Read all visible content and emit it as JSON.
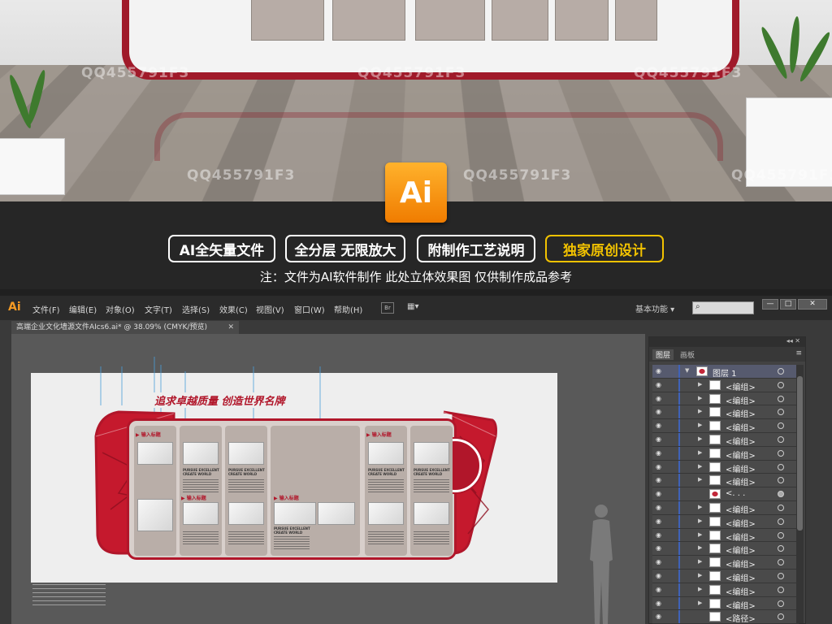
{
  "watermark_text": "QQ455791F3",
  "badge_ai": "Ai",
  "features": [
    "AI全矢量文件",
    "全分层 无限放大",
    "附制作工艺说明",
    "独家原创设计"
  ],
  "note": "注：文件为AI软件制作 此处立体效果图 仅供制作成品参考",
  "app": {
    "icon": "Ai",
    "menus": [
      "文件(F)",
      "编辑(E)",
      "对象(O)",
      "文字(T)",
      "选择(S)",
      "效果(C)",
      "视图(V)",
      "窗口(W)",
      "帮助(H)"
    ],
    "bridge_label": "Br",
    "workspace": "基本功能",
    "window_buttons": [
      "—",
      "□",
      "✕"
    ],
    "document_tab": "高端企业文化墙源文件AIcs6.ai* @ 38.09% (CMYK/预览)",
    "document_close": "✕"
  },
  "artboard": {
    "title": "追求卓越质量 创造世界名牌",
    "section_heading": "输入标题",
    "card_text": "PURSUE EXCELLENT CREATE WORLD"
  },
  "layers_panel": {
    "tabs": [
      "图层",
      "画板"
    ],
    "controls": "◂◂ ✕",
    "menu": "≡",
    "rows": [
      {
        "name": "图层 1",
        "level": 0,
        "arrow": "▼",
        "thumb": "red-small",
        "top": true
      },
      {
        "name": "<编组>",
        "level": 1,
        "arrow": "▶",
        "thumb": "plain"
      },
      {
        "name": "<编组>",
        "level": 1,
        "arrow": "▶",
        "thumb": "plain"
      },
      {
        "name": "<编组>",
        "level": 1,
        "arrow": "▶",
        "thumb": "plain"
      },
      {
        "name": "<编组>",
        "level": 1,
        "arrow": "▶",
        "thumb": "plain"
      },
      {
        "name": "<编组>",
        "level": 1,
        "arrow": "▶",
        "thumb": "plain"
      },
      {
        "name": "<编组>",
        "level": 1,
        "arrow": "▶",
        "thumb": "plain"
      },
      {
        "name": "<编组>",
        "level": 1,
        "arrow": "▶",
        "thumb": "plain"
      },
      {
        "name": "<编组>",
        "level": 1,
        "arrow": "▶",
        "thumb": "plain"
      },
      {
        "name": "<. . .",
        "level": 1,
        "arrow": "",
        "thumb": "red",
        "filled": true
      },
      {
        "name": "<编组>",
        "level": 1,
        "arrow": "▶",
        "thumb": "plain"
      },
      {
        "name": "<编组>",
        "level": 1,
        "arrow": "▶",
        "thumb": "plain"
      },
      {
        "name": "<编组>",
        "level": 1,
        "arrow": "▶",
        "thumb": "plain"
      },
      {
        "name": "<编组>",
        "level": 1,
        "arrow": "▶",
        "thumb": "plain"
      },
      {
        "name": "<编组>",
        "level": 1,
        "arrow": "▶",
        "thumb": "plain"
      },
      {
        "name": "<编组>",
        "level": 1,
        "arrow": "▶",
        "thumb": "plain"
      },
      {
        "name": "<编组>",
        "level": 1,
        "arrow": "▶",
        "thumb": "plain"
      },
      {
        "name": "<编组>",
        "level": 1,
        "arrow": "▶",
        "thumb": "plain"
      },
      {
        "name": "<路径>",
        "level": 1,
        "arrow": "",
        "thumb": "plain"
      }
    ]
  },
  "colors": {
    "brand_red": "#b1162a",
    "ai_orange": "#f59a23",
    "gold": "#f2c200"
  }
}
